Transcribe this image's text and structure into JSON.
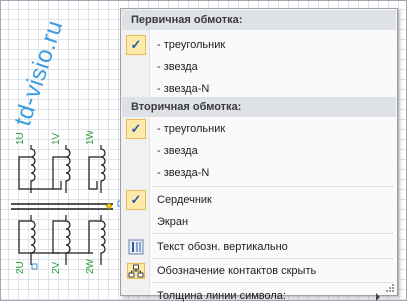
{
  "watermark": "td-visio.ru",
  "schematic": {
    "top_labels": [
      "1U",
      "1V",
      "1W"
    ],
    "bottom_labels": [
      "2U",
      "2V",
      "2W"
    ]
  },
  "menu": {
    "primary_header": "Первичная обмотка:",
    "primary_items": [
      {
        "label": "- треугольник",
        "checked": true
      },
      {
        "label": "- звезда",
        "checked": false
      },
      {
        "label": "- звезда-N",
        "checked": false
      }
    ],
    "secondary_header": "Вторичная обмотка:",
    "secondary_items": [
      {
        "label": "- треугольник",
        "checked": true
      },
      {
        "label": "- звезда",
        "checked": false
      },
      {
        "label": "- звезда-N",
        "checked": false
      }
    ],
    "core_label": "Сердечник",
    "core_checked": true,
    "screen_label": "Экран",
    "vertical_text_label": "Текст обозн. вертикально",
    "vertical_text_icon": "vertical-text-icon",
    "hide_contacts_label": "Обозначение контактов скрыть",
    "hide_contacts_icon": "contacts-hierarchy-icon",
    "line_width_label": "Толщина линии символа:",
    "colors": {
      "check_bg": "#fde9a8",
      "check_border": "#e9b95a",
      "header_bg": "#dee1e6"
    }
  }
}
